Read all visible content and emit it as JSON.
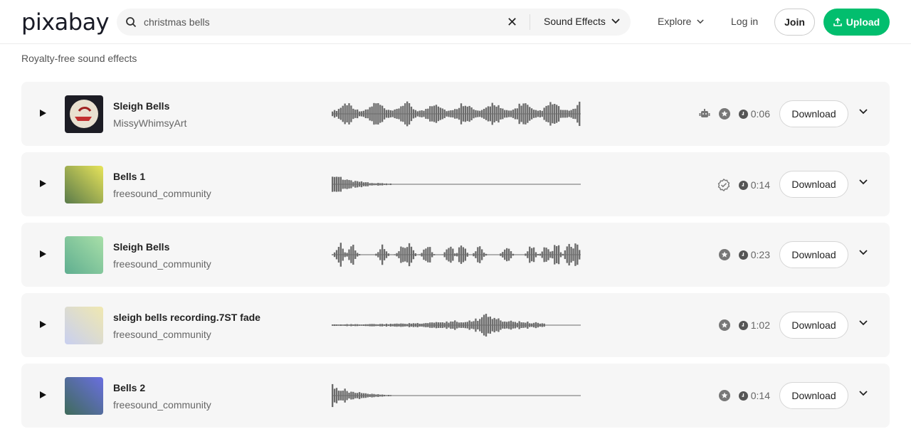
{
  "header": {
    "logo": "pixabay",
    "search_value": "christmas bells",
    "search_type": "Sound Effects",
    "explore": "Explore",
    "login": "Log in",
    "join": "Join",
    "upload": "Upload"
  },
  "colors": {
    "accent": "#02be6e",
    "waveform": "#6b6b6b"
  },
  "page_subtitle": "Royalty-free sound effects",
  "download_label": "Download",
  "tracks": [
    {
      "title": "Sleigh Bells",
      "author": "MissyWhimsyArt",
      "duration": "0:06",
      "badges": [
        "robot-icon",
        "star-badge-icon"
      ],
      "thumb": "linear-gradient(135deg,#1d1d25,#1d1d25)"
    },
    {
      "title": "Bells 1",
      "author": "freesound_community",
      "duration": "0:14",
      "badges": [
        "verified-badge-icon"
      ],
      "thumb": "linear-gradient(45deg,#5a7a4a,#e7e45a)"
    },
    {
      "title": "Sleigh Bells",
      "author": "freesound_community",
      "duration": "0:23",
      "badges": [
        "star-badge-icon"
      ],
      "thumb": "linear-gradient(45deg,#5fae90,#a8dfa8)"
    },
    {
      "title": "sleigh bells recording.7ST fade",
      "author": "freesound_community",
      "duration": "1:02",
      "badges": [
        "star-badge-icon"
      ],
      "thumb": "linear-gradient(45deg,#c8cff0,#f0e8b0)"
    },
    {
      "title": "Bells 2",
      "author": "freesound_community",
      "duration": "0:14",
      "badges": [
        "star-badge-icon"
      ],
      "thumb": "linear-gradient(45deg,#3f6b5a,#6a6fe0)"
    }
  ]
}
